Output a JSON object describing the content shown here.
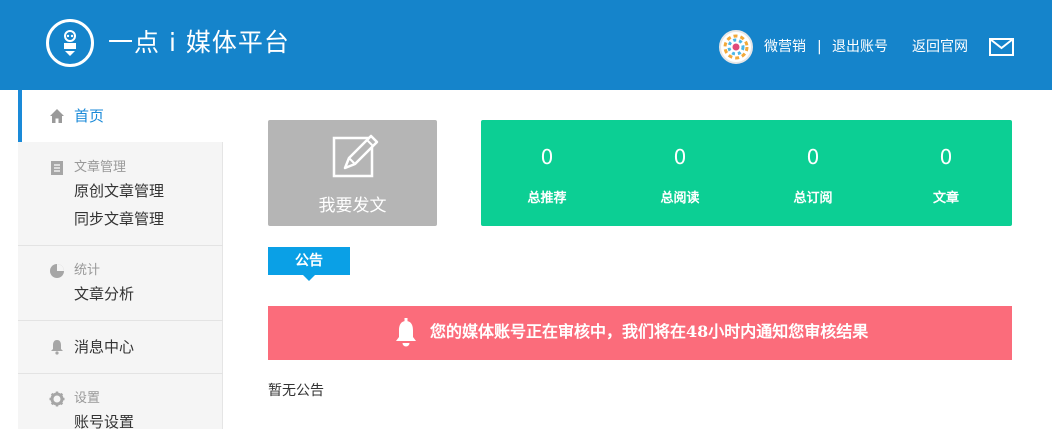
{
  "header": {
    "logo_text": "一点 i 媒体平台",
    "username": "微营销",
    "separator": "|",
    "logout": "退出账号",
    "back_home": "返回官网"
  },
  "sidebar": {
    "home": "首页",
    "groups": [
      {
        "title": "文章管理",
        "items": [
          "原创文章管理",
          "同步文章管理"
        ]
      },
      {
        "title": "统计",
        "items": [
          "文章分析"
        ]
      },
      {
        "title": "",
        "items": [
          "消息中心"
        ]
      },
      {
        "title": "设置",
        "items": [
          "账号设置"
        ]
      }
    ]
  },
  "main": {
    "write_label": "我要发文",
    "stats": [
      {
        "value": "0",
        "label": "总推荐"
      },
      {
        "value": "0",
        "label": "总阅读"
      },
      {
        "value": "0",
        "label": "总订阅"
      },
      {
        "value": "0",
        "label": "文章"
      }
    ],
    "notice_tab": "公告",
    "alert_text": "您的媒体账号正在审核中，我们将在48小时内通知您审核结果",
    "empty_notice": "暂无公告"
  },
  "colors": {
    "header": "#1584cb",
    "stats": "#0ccf94",
    "write_card": "#b5b5b5",
    "notice_tab": "#0aa0e6",
    "alert": "#fb6c7b",
    "sidebar_active": "#1a8ad8"
  }
}
